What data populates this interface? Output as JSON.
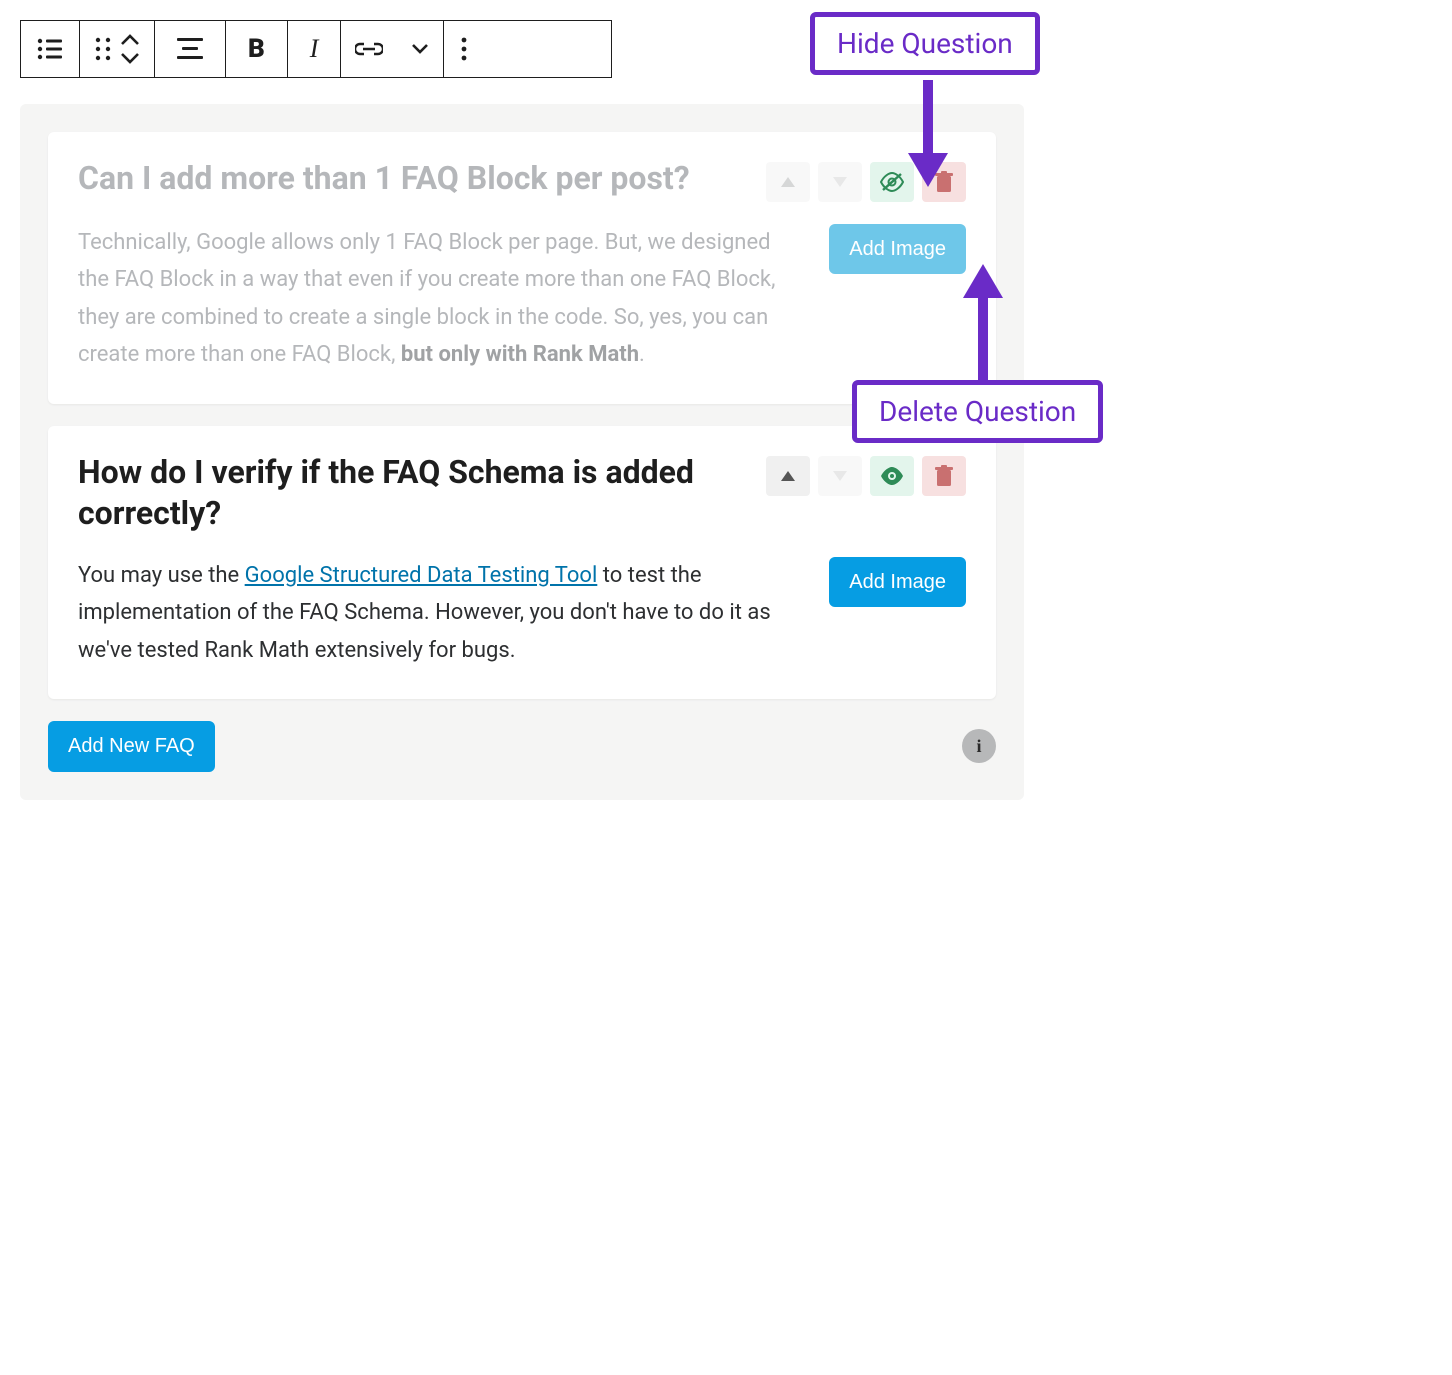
{
  "annotations": {
    "hide_label": "Hide Question",
    "delete_label": "Delete Question"
  },
  "faq": {
    "items": [
      {
        "question": "Can I add more than 1 FAQ Block per post?",
        "answer_pre": "Technically, Google allows only 1 FAQ Block per page. But, we designed the FAQ Block in a way that even if you create more than one FAQ Block, they are combined to create a single block in the code. So, yes, you can create more than one FAQ Block, ",
        "answer_strong": "but only with Rank Math",
        "answer_post": ".",
        "add_image_label": "Add Image"
      },
      {
        "question": "How do I verify if the FAQ Schema is added correctly?",
        "answer_pre": "You may use the ",
        "answer_link_text": "Google Structured Data Testing Tool",
        "answer_post": " to test the implementation of the FAQ Schema. However, you don't have to do it as we've tested Rank Math extensively for bugs.",
        "add_image_label": "Add Image"
      }
    ],
    "add_new_label": "Add New FAQ"
  }
}
